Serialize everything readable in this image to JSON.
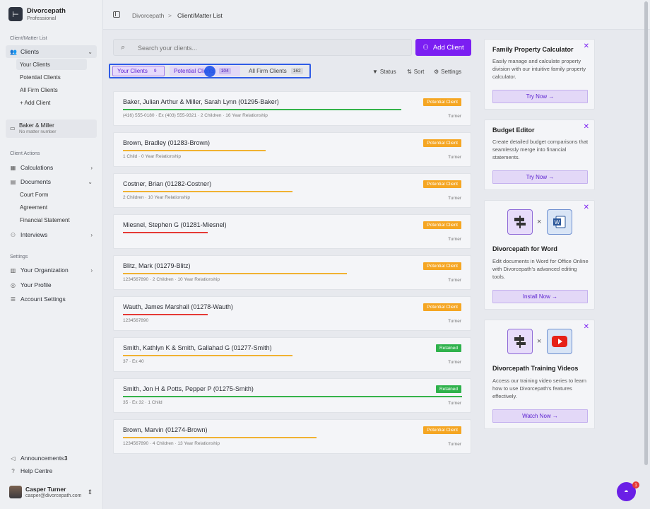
{
  "app": {
    "name": "Divorcepath",
    "plan": "Professional"
  },
  "sidebar": {
    "section_client": "Client/Matter List",
    "clients_label": "Clients",
    "client_sub": [
      "Your Clients",
      "Potential Clients",
      "All Firm Clients",
      "+ Add Client"
    ],
    "matter_name": "Baker & Miller",
    "matter_sub": "No matter number",
    "section_actions": "Client Actions",
    "calculations": "Calculations",
    "documents": "Documents",
    "doc_sub": [
      "Court Form",
      "Agreement",
      "Financial Statement"
    ],
    "interviews": "Interviews",
    "section_settings": "Settings",
    "your_org": "Your Organization",
    "your_profile": "Your Profile",
    "account_settings": "Account Settings",
    "announcements": "Announcements",
    "announcements_count": "3",
    "help": "Help Centre",
    "user_name": "Casper Turner",
    "user_email": "casper@divorcepath.com"
  },
  "breadcrumb": {
    "root": "Divorcepath",
    "sep": ">",
    "current": "Client/Matter List"
  },
  "search": {
    "placeholder": "Search your clients..."
  },
  "add_client": "Add Client",
  "tabs": [
    {
      "label": "Your Clients",
      "count": "9"
    },
    {
      "label": "Potential Clients",
      "count": "104"
    },
    {
      "label": "All Firm Clients",
      "count": "162"
    }
  ],
  "tools": {
    "status": "Status",
    "sort": "Sort",
    "settings": "Settings"
  },
  "colors": {
    "accent": "#7b1ff2",
    "potential": "#f5a623",
    "retained": "#2fb24c",
    "line_green": "#35b34a",
    "line_orange": "#f0b232",
    "line_red": "#e53935"
  },
  "clients": [
    {
      "name": "Baker, Julian Arthur & Miller, Sarah Lynn (01295-Baker)",
      "meta": "(416) 555-0180  ·  Ex (403) 555-9321  ·  2 Children  ·  16 Year Relationship",
      "owner": "Turner",
      "status": "Potential Client",
      "status_type": "potential",
      "bar_color": "line_green",
      "bar_pct": 0.82
    },
    {
      "name": "Brown, Bradley (01283-Brown)",
      "meta": "1 Child  ·  0 Year Relationship",
      "owner": "Turner",
      "status": "Potential Client",
      "status_type": "potential",
      "bar_color": "line_orange",
      "bar_pct": 0.42
    },
    {
      "name": "Costner, Brian (01282-Costner)",
      "meta": "2 Children  ·  10 Year Relationship",
      "owner": "Turner",
      "status": "Potential Client",
      "status_type": "potential",
      "bar_color": "line_orange",
      "bar_pct": 0.5
    },
    {
      "name": "Miesnel, Stephen G (01281-Miesnel)",
      "meta": "",
      "owner": "Turner",
      "status": "Potential Client",
      "status_type": "potential",
      "bar_color": "line_red",
      "bar_pct": 0.25
    },
    {
      "name": "Blitz, Mark (01279-Blitz)",
      "meta": "1234567890  ·  2 Children  ·  10 Year Relationship",
      "owner": "Turner",
      "status": "Potential Client",
      "status_type": "potential",
      "bar_color": "line_orange",
      "bar_pct": 0.66
    },
    {
      "name": "Wauth, James Marshall (01278-Wauth)",
      "meta": "1234567890",
      "owner": "Turner",
      "status": "Potential Client",
      "status_type": "potential",
      "bar_color": "line_red",
      "bar_pct": 0.25
    },
    {
      "name": "Smith, Kathlyn K & Smith, Gallahad G (01277-Smith)",
      "meta": "37  ·  Ex 40",
      "owner": "Turner",
      "status": "Retained",
      "status_type": "retained",
      "bar_color": "line_orange",
      "bar_pct": 0.5
    },
    {
      "name": "Smith, Jon H & Potts, Pepper P (01275-Smith)",
      "meta": "35  ·  Ex 32  ·  1 Child",
      "owner": "Turner",
      "status": "Retained",
      "status_type": "retained",
      "bar_color": "line_green",
      "bar_pct": 1.0
    },
    {
      "name": "Brown, Marvin (01274-Brown)",
      "meta": "1234567890  ·  4 Children  ·  13 Year Relationship",
      "owner": "Turner",
      "status": "Potential Client",
      "status_type": "potential",
      "bar_color": "line_orange",
      "bar_pct": 0.57
    }
  ],
  "promos": [
    {
      "title": "Family Property Calculator",
      "desc": "Easily manage and calculate property division with our intuitive family property calculator.",
      "button": "Try Now →"
    },
    {
      "title": "Budget Editor",
      "desc": "Create detailed budget comparisons that seamlessly merge into financial statements.",
      "button": "Try Now →"
    },
    {
      "title": "Divorcepath for Word",
      "desc": "Edit documents in Word for Office Online with Divorcepath's advanced editing tools.",
      "button": "Install Now →"
    },
    {
      "title": "Divorcepath Training Videos",
      "desc": "Access our training video series to learn how to use Divorcepath's features effectively.",
      "button": "Watch Now →"
    }
  ],
  "chat_badge": "1"
}
